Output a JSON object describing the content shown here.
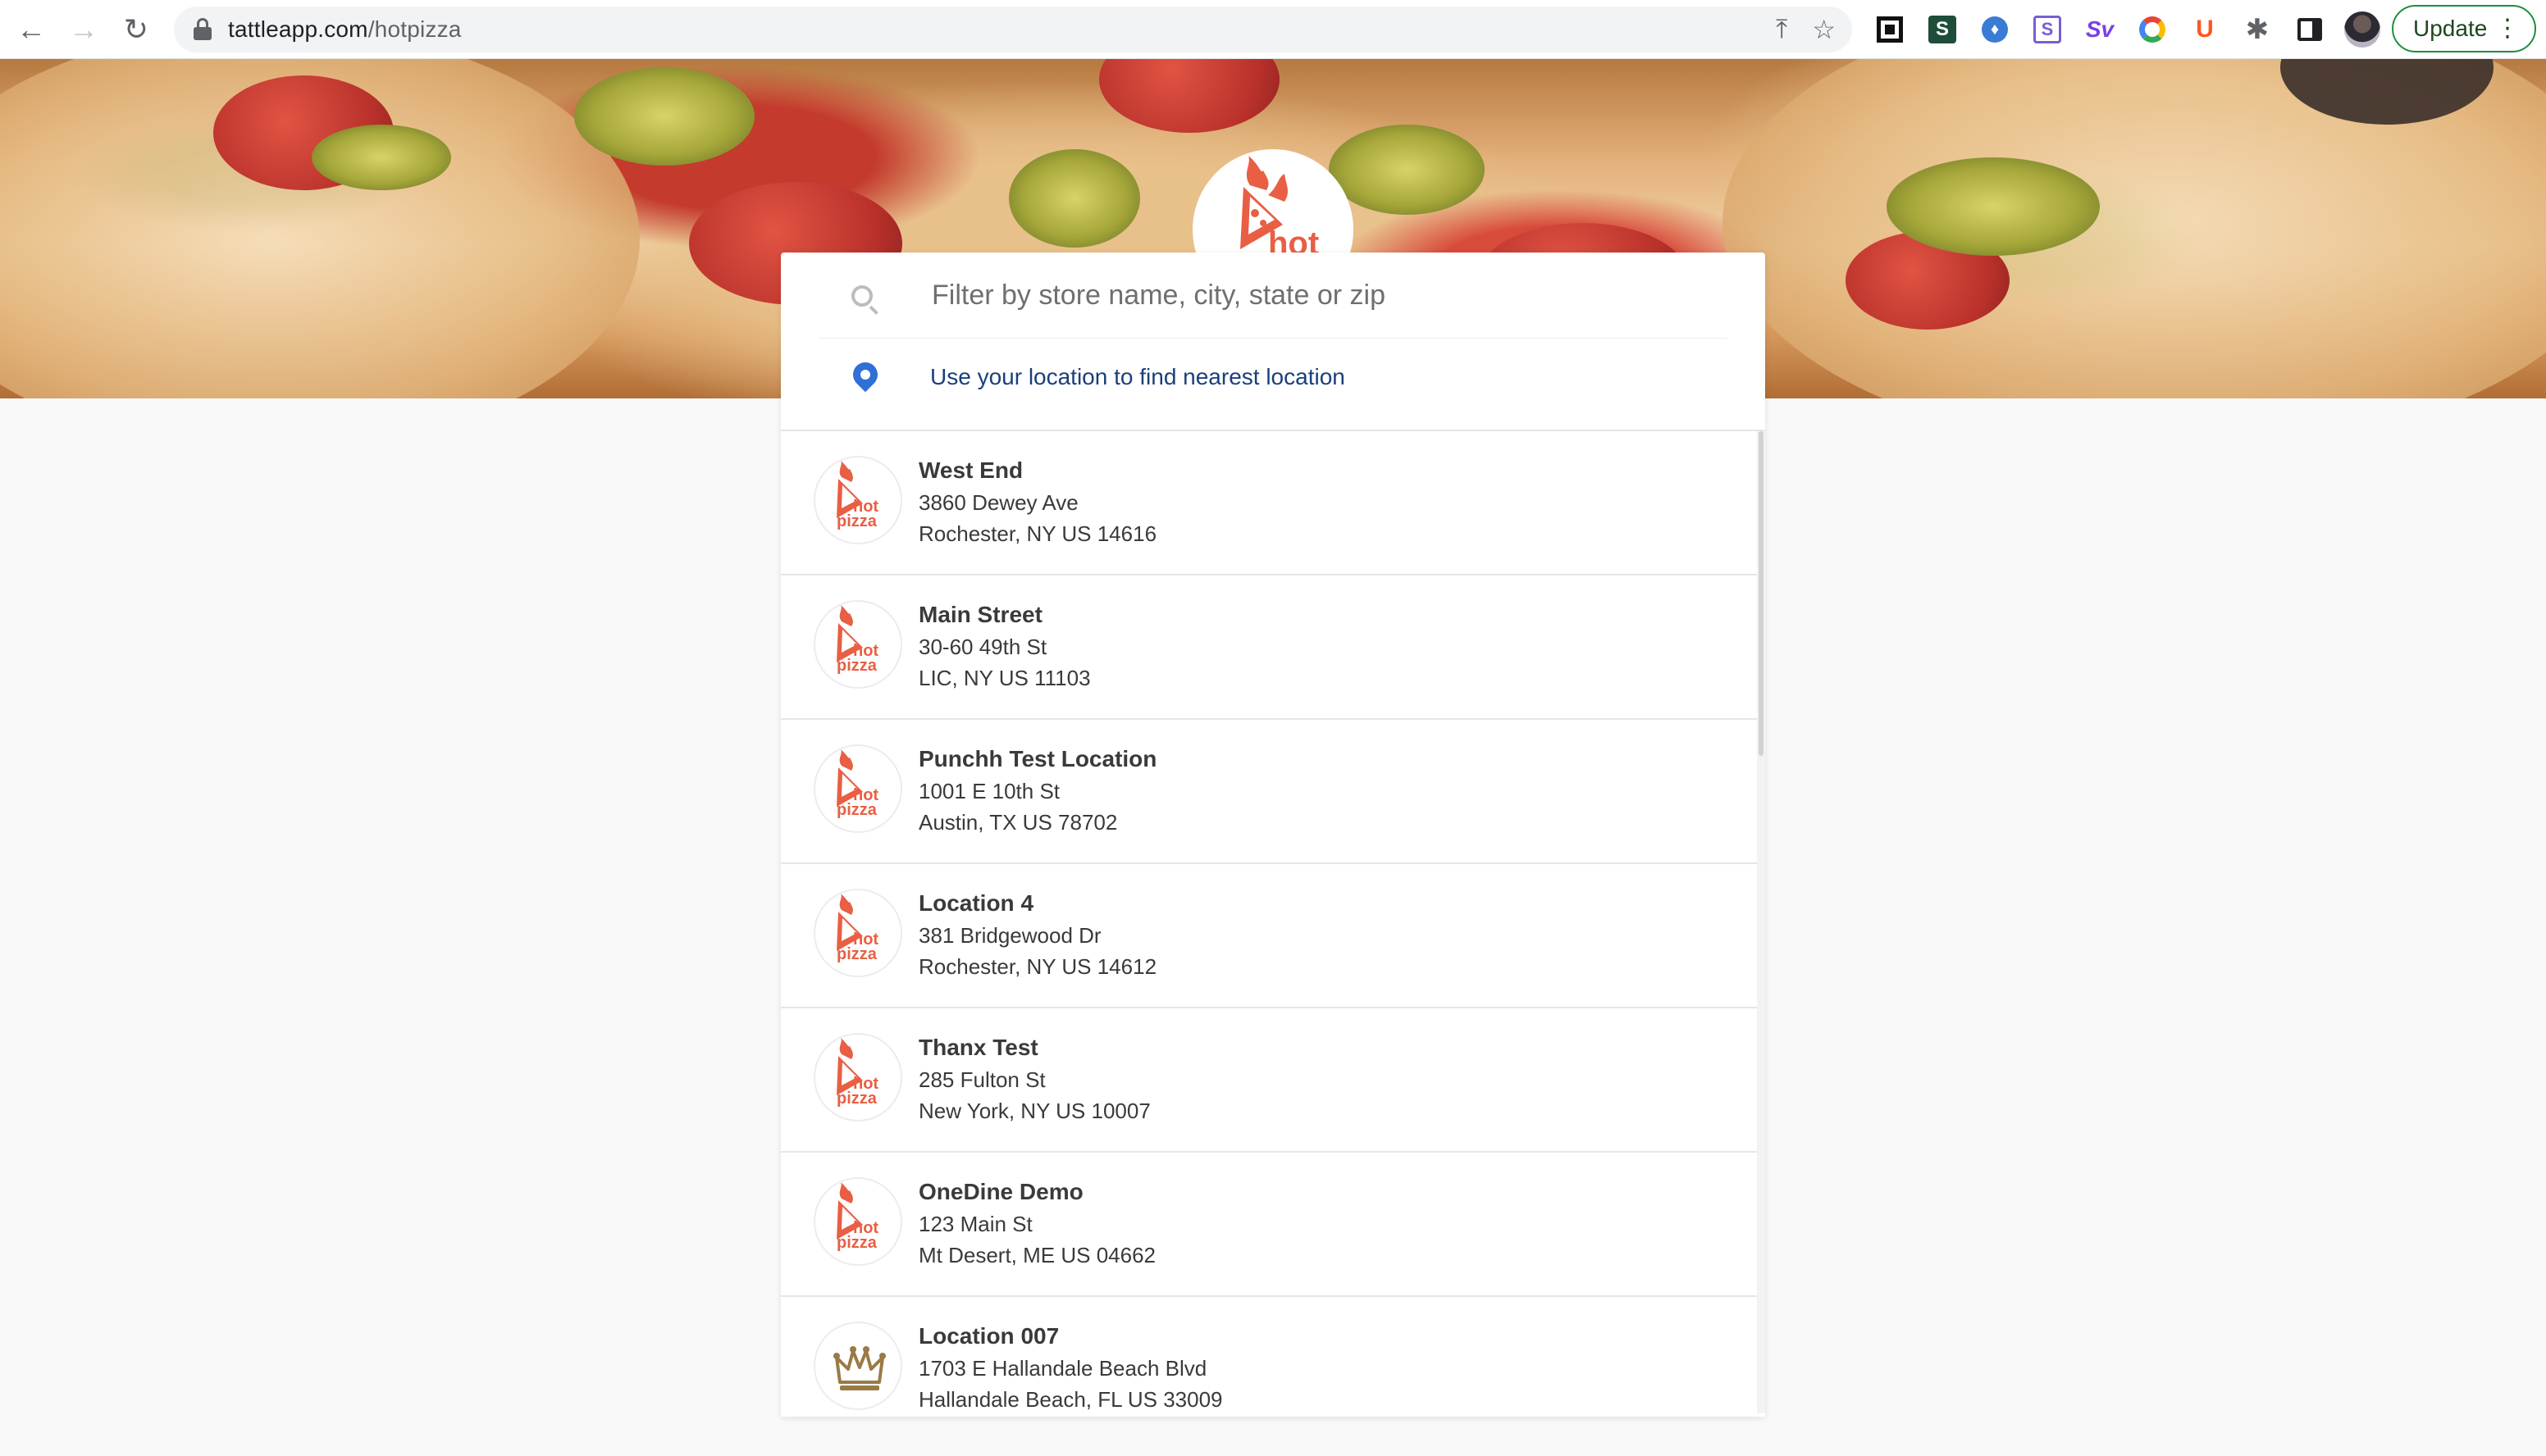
{
  "browser": {
    "url_host": "tattleapp.com",
    "url_path": "/hotpizza",
    "update_label": "Update",
    "extensions": [
      "square-ext-icon",
      "s-dark-ext-icon",
      "drop-ext-icon",
      "s-box-ext-icon",
      "sv-ext-icon",
      "ring-ext-icon",
      "u-ext-icon",
      "puzzle-icon",
      "side-panel-icon",
      "avatar"
    ]
  },
  "brand": {
    "name": "hot pizza",
    "logo_word_top": "hot",
    "logo_word_bottom": "pizza",
    "accent": "#e85f44"
  },
  "search": {
    "placeholder": "Filter by store name, city, state or zip",
    "value": ""
  },
  "locate": {
    "label": "Use your location to find nearest location"
  },
  "locations": [
    {
      "name": "West End",
      "street": "3860 Dewey Ave",
      "city_line": "Rochester, NY US 14616",
      "logo": "hotpizza"
    },
    {
      "name": "Main Street",
      "street": "30-60 49th St",
      "city_line": "LIC, NY US 11103",
      "logo": "hotpizza"
    },
    {
      "name": "Punchh Test Location",
      "street": "1001 E 10th St",
      "city_line": "Austin, TX US 78702",
      "logo": "hotpizza"
    },
    {
      "name": "Location 4",
      "street": "381 Bridgewood Dr",
      "city_line": "Rochester, NY US 14612",
      "logo": "hotpizza"
    },
    {
      "name": "Thanx Test",
      "street": "285 Fulton St",
      "city_line": "New York, NY US 10007",
      "logo": "hotpizza"
    },
    {
      "name": "OneDine Demo",
      "street": "123 Main St",
      "city_line": "Mt Desert, ME US 04662",
      "logo": "hotpizza"
    },
    {
      "name": "Location 007",
      "street": "1703 E Hallandale Beach Blvd",
      "city_line": "Hallandale Beach, FL US 33009",
      "logo": "crown"
    }
  ],
  "colors": {
    "page_bg": "#f9f9f9",
    "pin": "#2f6fd6",
    "text": "#3a3a3a",
    "locate_text": "#1a3f7a"
  }
}
